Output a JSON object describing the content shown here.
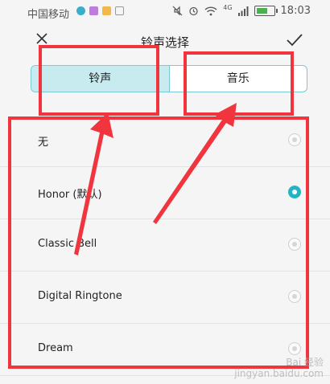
{
  "status_bar": {
    "carrier": "中国移动",
    "network": "4G",
    "time": "18:03"
  },
  "header": {
    "title": "铃声选择",
    "back_icon": "close-icon",
    "confirm_icon": "check-icon"
  },
  "tabs": [
    {
      "label": "铃声",
      "active": true
    },
    {
      "label": "音乐",
      "active": false
    }
  ],
  "ringtones": [
    {
      "label": "无",
      "selected": false
    },
    {
      "label": "Honor (默认)",
      "selected": true
    },
    {
      "label": "Classic Bell",
      "selected": false
    },
    {
      "label": "Digital Ringtone",
      "selected": false
    },
    {
      "label": "Dream",
      "selected": false
    }
  ],
  "colors": {
    "accent": "#22b4c4",
    "annotation": "#f0353f",
    "tab_active_bg": "#c7ebef"
  },
  "watermark": {
    "line1": "Bai 经验",
    "line2": "jingyan.baidu.com"
  }
}
